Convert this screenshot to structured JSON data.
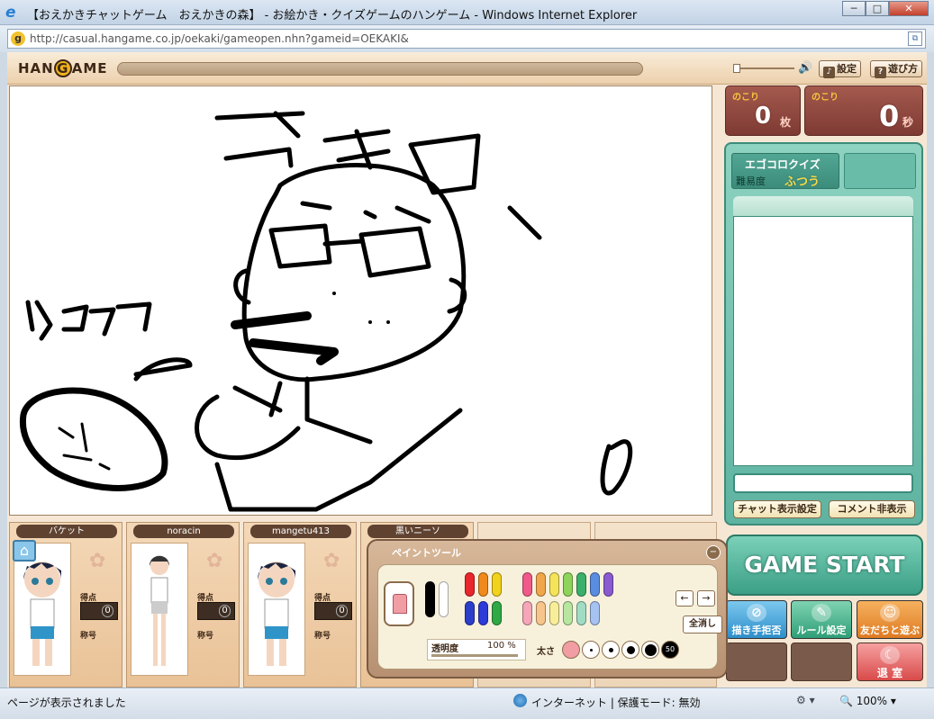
{
  "window": {
    "title": "【おえかきチャットゲーム　おえかきの森】 - お絵かき・クイズゲームのハンゲーム - Windows Internet Explorer",
    "min": "─",
    "max": "□",
    "close": "✕"
  },
  "address": {
    "url": "http://casual.hangame.co.jp/oekaki/gameopen.nhn?gameid=OEKAKI&"
  },
  "header": {
    "logo": "HANGAME",
    "settings_label": "設定",
    "howto_label": "遊び方"
  },
  "counters": {
    "remaining_label": "のこり",
    "cards_value": "0",
    "cards_unit": "枚",
    "seconds_value": "0",
    "seconds_unit": "秒"
  },
  "quiz": {
    "name": "エゴコロクイズ",
    "difficulty_label": "難易度",
    "difficulty_value": "ふつう",
    "chat_display_button": "チャット表示設定",
    "comment_hide_button": "コメント非表示"
  },
  "actions": {
    "game_start": "GAME START",
    "reject_drawer": "描き手拒否",
    "rule_settings": "ルール設定",
    "play_with_friends": "友だちと遊ぶ",
    "exit": "退 室"
  },
  "players": [
    {
      "name": "バケット",
      "score_label": "得点",
      "score": "0",
      "title_label": "称号"
    },
    {
      "name": "noracin",
      "score_label": "得点",
      "score": "0",
      "title_label": "称号"
    },
    {
      "name": "mangetu413",
      "score_label": "得点",
      "score": "0",
      "title_label": "称号"
    },
    {
      "name": "黒いニーソ"
    }
  ],
  "paint_tool": {
    "title": "ペイントツール",
    "clear_all": "全消し",
    "opacity_label": "透明度",
    "opacity_value": "100 %",
    "size_label": "太さ",
    "size_max": "50",
    "colors_main": [
      "#000000",
      "#ffffff",
      "#e8262b",
      "#f08a1c",
      "#f2d21b",
      "#2b3ec9",
      "#2d3bd9",
      "#2fa845"
    ],
    "colors_light": [
      "#f05a8a",
      "#f2a64a",
      "#f5e35a",
      "#8ed35a",
      "#3ab06a",
      "#5a8de0",
      "#8a5ad0"
    ],
    "colors_pale": [
      "#f5a6b8",
      "#f7c48c",
      "#f8ee9a",
      "#b8e6a0",
      "#a0dcc4",
      "#a6c2f0"
    ]
  },
  "status": {
    "text": "ページが表示されました",
    "zone": "インターネット | 保護モード: 無効",
    "zoom": "100%"
  }
}
